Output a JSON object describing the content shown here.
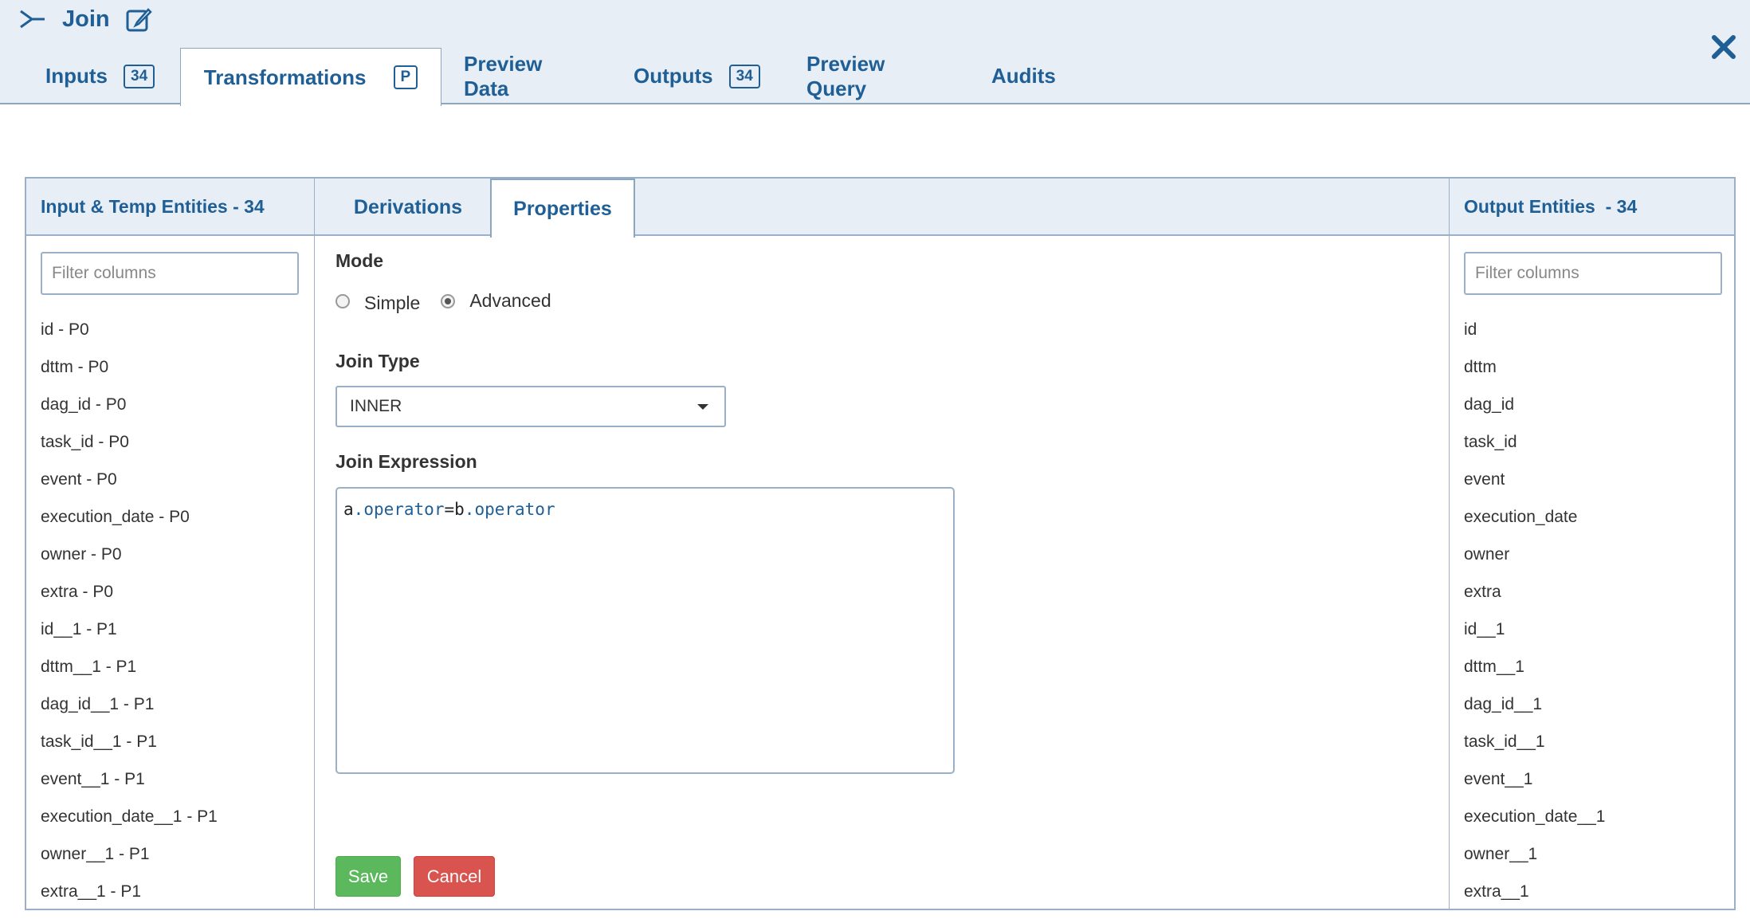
{
  "header": {
    "title": "Join",
    "tabs": [
      {
        "label": "Inputs",
        "badge": "34"
      },
      {
        "label": "Transformations",
        "badge": "P"
      },
      {
        "label": "Preview Data"
      },
      {
        "label": "Outputs",
        "badge": "34"
      },
      {
        "label": "Preview Query"
      },
      {
        "label": "Audits"
      }
    ]
  },
  "left_panel": {
    "title": "Input & Temp Entities - 34",
    "filter_placeholder": "Filter columns",
    "items": [
      "id - P0",
      "dttm - P0",
      "dag_id - P0",
      "task_id - P0",
      "event - P0",
      "execution_date - P0",
      "owner - P0",
      "extra - P0",
      "id__1 - P1",
      "dttm__1 - P1",
      "dag_id__1 - P1",
      "task_id__1 - P1",
      "event__1 - P1",
      "execution_date__1 - P1",
      "owner__1 - P1",
      "extra__1 - P1"
    ]
  },
  "middle_panel": {
    "tabs": [
      {
        "label": "Derivations"
      },
      {
        "label": "Properties"
      }
    ],
    "mode_label": "Mode",
    "mode_options": [
      "Simple",
      "Advanced"
    ],
    "mode_selected": "Advanced",
    "join_type_label": "Join Type",
    "join_type_value": "INNER",
    "join_expression_label": "Join Expression",
    "expression": {
      "a": "a",
      "dot1": ".",
      "field1": "operator",
      "eq": "=",
      "b": "b",
      "dot2": ".",
      "field2": "operator"
    },
    "save_label": "Save",
    "cancel_label": "Cancel"
  },
  "right_panel": {
    "title": "Output Entities  - 34",
    "filter_placeholder": "Filter columns",
    "items": [
      "id",
      "dttm",
      "dag_id",
      "task_id",
      "event",
      "execution_date",
      "owner",
      "extra",
      "id__1",
      "dttm__1",
      "dag_id__1",
      "task_id__1",
      "event__1",
      "execution_date__1",
      "owner__1",
      "extra__1"
    ]
  },
  "colors": {
    "accent": "#1f5f95",
    "header_bg": "#e8eef5",
    "save": "#5cb85c",
    "cancel": "#d9534f"
  }
}
